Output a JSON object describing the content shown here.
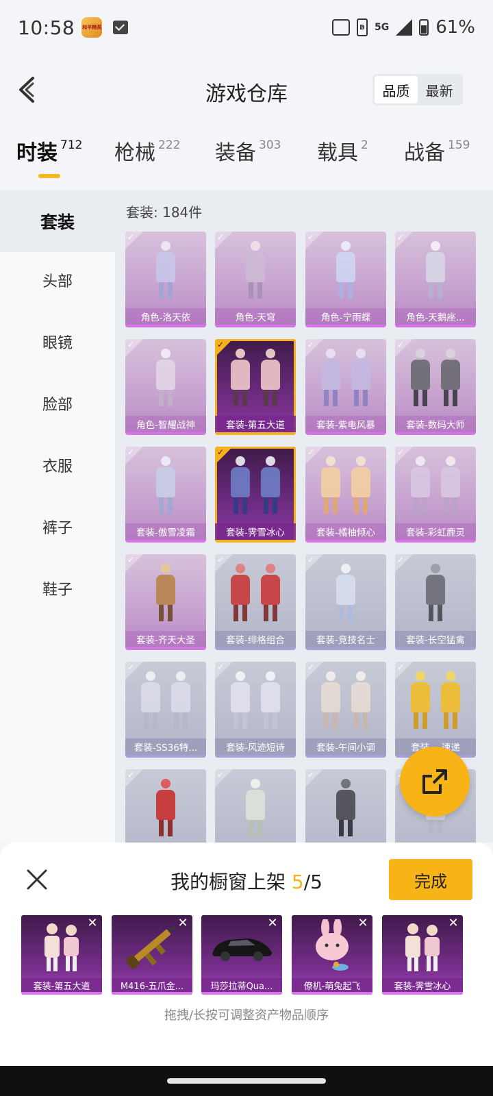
{
  "status_bar": {
    "time": "10:58",
    "app_badge": "和平精英",
    "network": "5G",
    "sim": "B",
    "battery": "61%"
  },
  "header": {
    "title": "游戏仓库",
    "sort_options": [
      "品质",
      "最新"
    ],
    "sort_selected": "品质"
  },
  "tabs": [
    {
      "label": "时装",
      "count": "712",
      "active": true
    },
    {
      "label": "枪械",
      "count": "222",
      "active": false
    },
    {
      "label": "装备",
      "count": "303",
      "active": false
    },
    {
      "label": "载具",
      "count": "2",
      "active": false
    },
    {
      "label": "战备",
      "count": "159",
      "active": false
    }
  ],
  "sidebar": {
    "items": [
      "套装",
      "头部",
      "眼镜",
      "脸部",
      "衣服",
      "裤子",
      "鞋子"
    ],
    "selected": "套装"
  },
  "content": {
    "count_label": "套装: 184件",
    "items": [
      {
        "name": "角色-洛天依",
        "tier": "purple",
        "selected": false
      },
      {
        "name": "角色-天穹",
        "tier": "purple",
        "selected": false
      },
      {
        "name": "角色-宁雨蝶",
        "tier": "purple",
        "selected": false
      },
      {
        "name": "角色-天鹅座...",
        "tier": "purple",
        "selected": false
      },
      {
        "name": "角色-智耀战神",
        "tier": "purple",
        "selected": false
      },
      {
        "name": "套装-第五大道",
        "tier": "purple",
        "selected": true
      },
      {
        "name": "套装-紫电风暴",
        "tier": "purple",
        "selected": false
      },
      {
        "name": "套装-数码大师",
        "tier": "purple",
        "selected": false
      },
      {
        "name": "套装-傲雪凌霜",
        "tier": "purple",
        "selected": false
      },
      {
        "name": "套装-霁雪冰心",
        "tier": "purple",
        "selected": true
      },
      {
        "name": "套装-橘柚倾心",
        "tier": "purple",
        "selected": false
      },
      {
        "name": "套装-彩虹鹿灵",
        "tier": "purple",
        "selected": false
      },
      {
        "name": "套装-齐天大圣",
        "tier": "purple",
        "selected": false
      },
      {
        "name": "套装-绯格组合",
        "tier": "grey",
        "selected": false
      },
      {
        "name": "套装-竞技名士",
        "tier": "grey",
        "selected": false
      },
      {
        "name": "套装-长空猛禽",
        "tier": "grey",
        "selected": false
      },
      {
        "name": "套装-SS36特...",
        "tier": "grey",
        "selected": false
      },
      {
        "name": "套装-风迹短诗",
        "tier": "grey",
        "selected": false
      },
      {
        "name": "套装-午间小调",
        "tier": "grey",
        "selected": false
      },
      {
        "name": "套装-...速递",
        "tier": "grey",
        "selected": false
      },
      {
        "name": "",
        "tier": "grey",
        "selected": false
      },
      {
        "name": "",
        "tier": "grey",
        "selected": false
      },
      {
        "name": "",
        "tier": "grey",
        "selected": false
      },
      {
        "name": "",
        "tier": "grey",
        "selected": false
      }
    ]
  },
  "panel": {
    "title_prefix": "我的橱窗上架 ",
    "title_current": "5",
    "title_suffix": "/5",
    "done_label": "完成",
    "shelf": [
      {
        "name": "套装-第五大道",
        "icon": "outfit-icon"
      },
      {
        "name": "M416-五爪金...",
        "icon": "rifle-icon"
      },
      {
        "name": "玛莎拉蒂Qua...",
        "icon": "car-icon"
      },
      {
        "name": "僚机-萌兔起飞",
        "icon": "bunny-icon"
      },
      {
        "name": "套装-霁雪冰心",
        "icon": "outfit-icon"
      }
    ],
    "hint": "拖拽/长按可调整资产物品顺序"
  },
  "colors": {
    "accent": "#f8b316",
    "purple_card": "#c6a2cf",
    "grey_card": "#b2b5c8",
    "selected_card": "#6e2c82"
  }
}
